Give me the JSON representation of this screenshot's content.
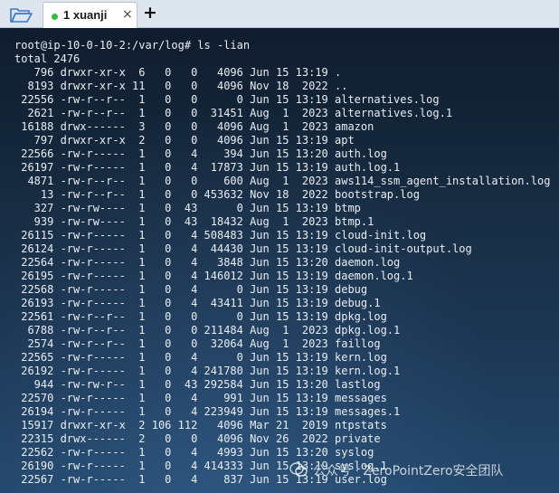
{
  "tab": {
    "title": "1 xuanji",
    "close_glyph": "×",
    "new_glyph": "+"
  },
  "icons": {
    "folder": "folder-open-icon",
    "status": "connected-status-dot"
  },
  "colors": {
    "status_dot": "#2fbf3a",
    "folder": "#3a78c9"
  },
  "terminal": {
    "lines": [
      "root@ip-10-0-10-2:/var/log# ls -lian",
      "total 2476",
      "   796 drwxr-xr-x  6   0   0   4096 Jun 15 13:19 .",
      "  8193 drwxr-xr-x 11   0   0   4096 Nov 18  2022 ..",
      " 22556 -rw-r--r--  1   0   0      0 Jun 15 13:19 alternatives.log",
      "  2621 -rw-r--r--  1   0   0  31451 Aug  1  2023 alternatives.log.1",
      " 16188 drwx------  3   0   0   4096 Aug  1  2023 amazon",
      "   797 drwxr-xr-x  2   0   0   4096 Jun 15 13:19 apt",
      " 22566 -rw-r-----  1   0   4    394 Jun 15 13:20 auth.log",
      " 26197 -rw-r-----  1   0   4  17873 Jun 15 13:19 auth.log.1",
      "  4871 -rw-r--r--  1   0   0    600 Aug  1  2023 aws114_ssm_agent_installation.log",
      "    13 -rw-r--r--  1   0   0 453632 Nov 18  2022 bootstrap.log",
      "   327 -rw-rw----  1   0  43      0 Jun 15 13:19 btmp",
      "   939 -rw-rw----  1   0  43  18432 Aug  1  2023 btmp.1",
      " 26115 -rw-r-----  1   0   4 508483 Jun 15 13:19 cloud-init.log",
      " 26124 -rw-r-----  1   0   4  44430 Jun 15 13:19 cloud-init-output.log",
      " 22564 -rw-r-----  1   0   4   3848 Jun 15 13:20 daemon.log",
      " 26195 -rw-r-----  1   0   4 146012 Jun 15 13:19 daemon.log.1",
      " 22568 -rw-r-----  1   0   4      0 Jun 15 13:19 debug",
      " 26193 -rw-r-----  1   0   4  43411 Jun 15 13:19 debug.1",
      " 22561 -rw-r--r--  1   0   0      0 Jun 15 13:19 dpkg.log",
      "  6788 -rw-r--r--  1   0   0 211484 Aug  1  2023 dpkg.log.1",
      "  2574 -rw-r--r--  1   0   0  32064 Aug  1  2023 faillog",
      " 22565 -rw-r-----  1   0   4      0 Jun 15 13:19 kern.log",
      " 26192 -rw-r-----  1   0   4 241780 Jun 15 13:19 kern.log.1",
      "   944 -rw-rw-r--  1   0  43 292584 Jun 15 13:20 lastlog",
      " 22570 -rw-r-----  1   0   4    991 Jun 15 13:19 messages",
      " 26194 -rw-r-----  1   0   4 223949 Jun 15 13:19 messages.1",
      " 15917 drwxr-xr-x  2 106 112   4096 Mar 21  2019 ntpstats",
      " 22315 drwx------  2   0   0   4096 Nov 26  2022 private",
      " 22562 -rw-r-----  1   0   4   4993 Jun 15 13:20 syslog",
      " 26190 -rw-r-----  1   0   4 414333 Jun 15 13:19 syslog.1",
      " 22567 -rw-r-----  1   0   4    837 Jun 15 13:19 user.log"
    ]
  },
  "watermark": {
    "text": "公众号 · ZeroPointZero安全团队"
  }
}
